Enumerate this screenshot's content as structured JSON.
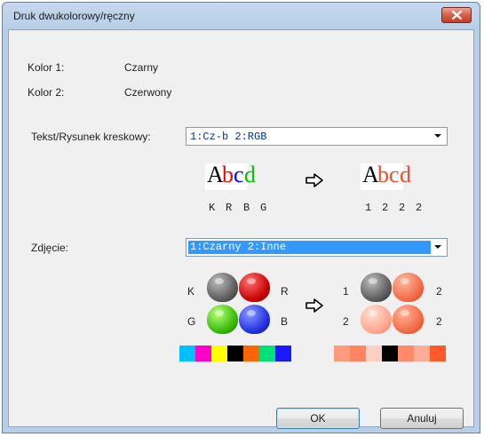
{
  "window": {
    "title": "Druk dwukolorowy/ręczny"
  },
  "kolor1": {
    "label": "Kolor 1:",
    "value": "Czarny"
  },
  "kolor2": {
    "label": "Kolor 2:",
    "value": "Czerwony"
  },
  "text_line": {
    "label": "Tekst/Rysunek kreskowy:",
    "selected": "1:Cz-b 2:RGB",
    "sample_before": [
      "A",
      "b",
      "c",
      "d"
    ],
    "sample_after": [
      "A",
      "b",
      "c",
      "d"
    ],
    "letters_before": [
      "K",
      "R",
      "B",
      "G"
    ],
    "letters_after": [
      "1",
      "2",
      "2",
      "2"
    ]
  },
  "photo": {
    "label": "Zdjęcie:",
    "selected": "1:Czarny 2:Inne",
    "left_labels": {
      "tl": "K",
      "tr": "R",
      "bl": "G",
      "br": "B"
    },
    "right_labels": {
      "tl": "1",
      "tr": "2",
      "bl": "2",
      "br": "2"
    }
  },
  "colors": {
    "before_swatches": [
      "#00bfff",
      "#ff00cc",
      "#ffff00",
      "#000000",
      "#ff6600",
      "#00e07a",
      "#1a1aff"
    ],
    "after_swatches": [
      "#ff9a7f",
      "#ff8462",
      "#ffcfc2",
      "#000000",
      "#ff8a6a",
      "#ffac96",
      "#ff5a2a"
    ]
  },
  "buttons": {
    "ok": "OK",
    "cancel": "Anuluj"
  }
}
